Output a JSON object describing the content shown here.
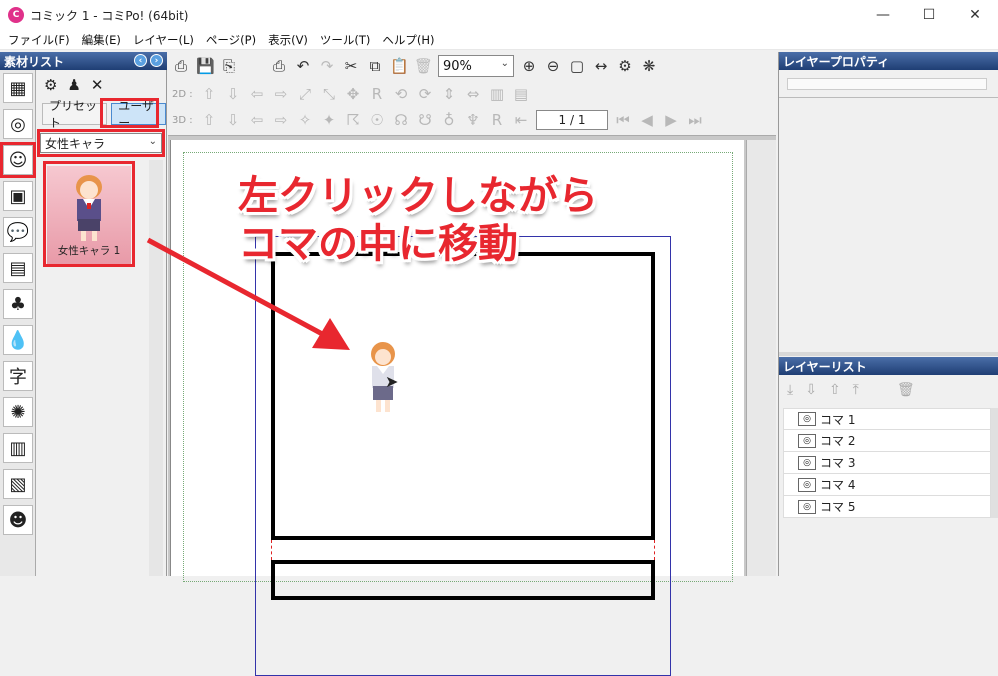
{
  "window": {
    "title": "コミック 1 - コミPo! (64bit)",
    "controls": [
      "—",
      "☐",
      "✕"
    ]
  },
  "menu": [
    "ファイル(F)",
    "編集(E)",
    "レイヤー(L)",
    "ページ(P)",
    "表示(V)",
    "ツール(T)",
    "ヘルプ(H)"
  ],
  "left_panel": {
    "title": "素材リスト",
    "tabs": [
      "プリセット",
      "ユーザー"
    ],
    "category_select": "女性キャラ",
    "asset": "女性キャラ 1"
  },
  "toolbar": {
    "zoom": "90%",
    "row2_label": "2D :",
    "row3_label": "3D :",
    "page_indicator": "1 / 1"
  },
  "annotation": {
    "line1": "左クリックしながら",
    "line2": "コマの中に移動",
    "color": "#e8272f"
  },
  "right_panel": {
    "property_title": "レイヤープロパティ",
    "list_title": "レイヤーリスト",
    "layers": [
      "コマ 1",
      "コマ 2",
      "コマ 3",
      "コマ 4",
      "コマ 5"
    ]
  }
}
